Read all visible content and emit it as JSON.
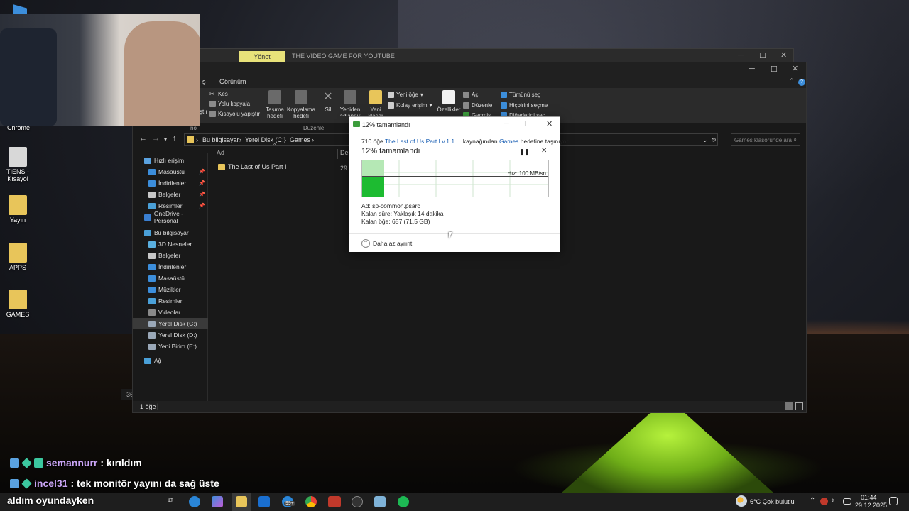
{
  "desktop": {
    "icons": [
      {
        "label": "Chrome",
        "icon": "chrome-icon"
      },
      {
        "label": "TIENS - Kısayol",
        "icon": "shortcut-icon"
      },
      {
        "label": "Yayın",
        "icon": "folder-icon"
      },
      {
        "label": "APPS",
        "icon": "folder-icon"
      },
      {
        "label": "GAMES",
        "icon": "folder-icon"
      }
    ],
    "left_number": "36"
  },
  "back_window": {
    "tab_label": "Yönet",
    "title": "THE VIDEO GAME FOR YOUTUBE"
  },
  "explorer": {
    "menu": {
      "item_partial": "ş",
      "view": "Görünüm"
    },
    "ribbon": {
      "clipboard": {
        "cut": "Kes",
        "copy_path": "Yolu kopyala",
        "paste_shortcut": "Kısayolu yapıştır",
        "paste_partial": "ştır",
        "group_partial": "no"
      },
      "organize": {
        "move_to": "Taşıma hedefi",
        "copy_to": "Kopyalama hedefi",
        "delete": "Sil",
        "rename": "Yeniden adlandır",
        "group_label": "Düzenle"
      },
      "new": {
        "new_folder": "Yeni klasör",
        "new_item": "Yeni öğe",
        "easy_access": "Kolay erişim"
      },
      "open": {
        "properties": "Özellikler",
        "open": "Aç",
        "edit": "Düzenle",
        "history": "Geçmiş"
      },
      "select": {
        "select_all": "Tümünü seç",
        "select_none": "Hiçbirini seçme",
        "invert": "Diğerlerini seç"
      }
    },
    "address": {
      "crumbs": [
        "Bu bilgisayar",
        "Yerel Disk (C:)",
        "Games"
      ],
      "search_placeholder": "Games klasöründe ara"
    },
    "nav": [
      {
        "label": "Hızlı erişim",
        "color": "#5aa2e0",
        "pinned": false,
        "indent": 16,
        "sel": false
      },
      {
        "label": "Masaüstü",
        "color": "#3c8edb",
        "pinned": true,
        "indent": 22,
        "sel": false
      },
      {
        "label": "İndirilenler",
        "color": "#3c8edb",
        "pinned": true,
        "indent": 22,
        "sel": false
      },
      {
        "label": "Belgeler",
        "color": "#c8c8c8",
        "pinned": true,
        "indent": 22,
        "sel": false
      },
      {
        "label": "Resimler",
        "color": "#4aa0d8",
        "pinned": true,
        "indent": 22,
        "sel": false
      },
      {
        "label": "OneDrive - Personal",
        "color": "#3a7fd0",
        "pinned": false,
        "indent": 16,
        "sel": false
      },
      {
        "label": "Bu bilgisayar",
        "color": "#4aa0d8",
        "pinned": false,
        "indent": 16,
        "sel": false
      },
      {
        "label": "3D Nesneler",
        "color": "#5ab0e0",
        "pinned": false,
        "indent": 22,
        "sel": false
      },
      {
        "label": "Belgeler",
        "color": "#c8c8c8",
        "pinned": false,
        "indent": 22,
        "sel": false
      },
      {
        "label": "İndirilenler",
        "color": "#3c8edb",
        "pinned": false,
        "indent": 22,
        "sel": false
      },
      {
        "label": "Masaüstü",
        "color": "#3c8edb",
        "pinned": false,
        "indent": 22,
        "sel": false
      },
      {
        "label": "Müzikler",
        "color": "#3c8edb",
        "pinned": false,
        "indent": 22,
        "sel": false
      },
      {
        "label": "Resimler",
        "color": "#4aa0d8",
        "pinned": false,
        "indent": 22,
        "sel": false
      },
      {
        "label": "Videolar",
        "color": "#8a8a8a",
        "pinned": false,
        "indent": 22,
        "sel": false
      },
      {
        "label": "Yerel Disk (C:)",
        "color": "#9aa8b8",
        "pinned": false,
        "indent": 22,
        "sel": true
      },
      {
        "label": "Yerel Disk (D:)",
        "color": "#9aa8b8",
        "pinned": false,
        "indent": 22,
        "sel": false
      },
      {
        "label": "Yeni Birim (E:)",
        "color": "#9aa8b8",
        "pinned": false,
        "indent": 22,
        "sel": false
      },
      {
        "label": "Ağ",
        "color": "#4aa0d8",
        "pinned": false,
        "indent": 16,
        "sel": false
      }
    ],
    "columns": {
      "name": "Ad",
      "date_partial": "Değ"
    },
    "rows": [
      {
        "name": "The Last of Us Part I",
        "date_partial": "29.1"
      }
    ],
    "status": "1 öğe"
  },
  "copy_dialog": {
    "title": "12% tamamlandı",
    "line_count": "710 öğe",
    "line_source": "The Last of Us Part I v.1.1....",
    "line_mid": "kaynağından",
    "line_dest": "Games",
    "line_end": "hedefine taşınıyor",
    "percent_label": "12%  tamamlandı",
    "speed": "Hız: 100 MB/sn",
    "progress": 0.12,
    "name": "Ad:  sp-common.psarc",
    "time_left": "Kalan süre:  Yaklaşık 14 dakika",
    "items_left": "Kalan öğe:  657 (71,5 GB)",
    "less_details": "Daha az ayrıntı"
  },
  "chat": [
    {
      "user": "semannurr",
      "message": ": kırıldım"
    },
    {
      "user": "incel31",
      "message": ": tek monitör yayını da sağ üste"
    }
  ],
  "taskbar": {
    "caption": "aldım oyundayken",
    "mail_badge": "99+",
    "weather": "6°C  Çok bulutlu",
    "time": "01:44",
    "date": "29.12.2025"
  }
}
